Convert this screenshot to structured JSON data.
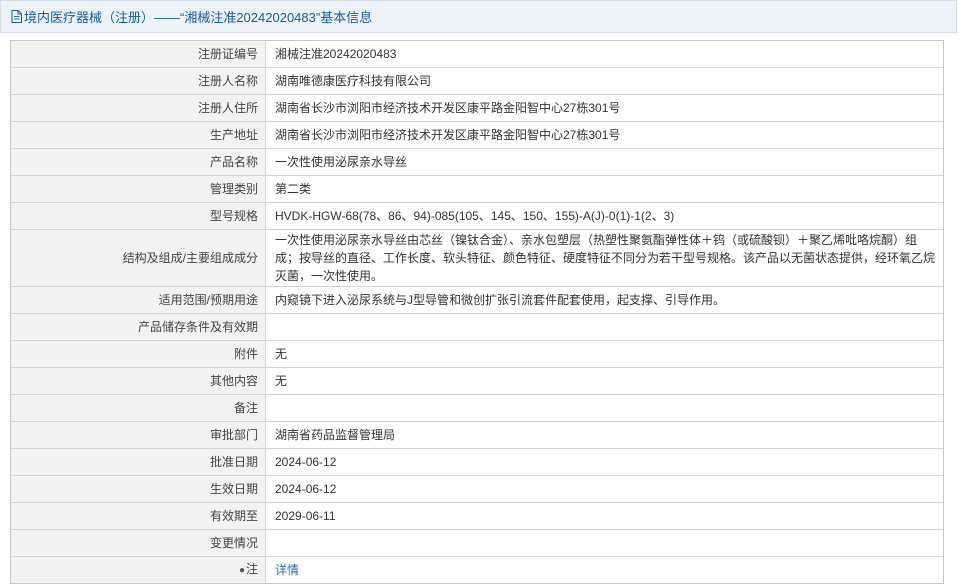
{
  "header": {
    "title": "境内医疗器械（注册）——“湘械注准20242020483”基本信息",
    "icon": "document-icon"
  },
  "rows": [
    {
      "label": "注册证编号",
      "value": "湘械注准20242020483"
    },
    {
      "label": "注册人名称",
      "value": "湖南唯德康医疗科技有限公司"
    },
    {
      "label": "注册人住所",
      "value": "湖南省长沙市浏阳市经济技术开发区康平路金阳智中心27栋301号"
    },
    {
      "label": "生产地址",
      "value": "湖南省长沙市浏阳市经济技术开发区康平路金阳智中心27栋301号"
    },
    {
      "label": "产品名称",
      "value": "一次性使用泌尿亲水导丝"
    },
    {
      "label": "管理类别",
      "value": "第二类"
    },
    {
      "label": "型号规格",
      "value": "HVDK-HGW-68(78、86、94)-085(105、145、150、155)-A(J)-0(1)-1(2、3)"
    },
    {
      "label": "结构及组成/主要组成成分",
      "value": "一次性使用泌尿亲水导丝由芯丝（镍钛合金）、亲水包塑层（热塑性聚氨酯弹性体＋钨（或硫酸钡）＋聚乙烯吡咯烷酮）组成；按导丝的直径、工作长度、软头特征、颜色特征、硬度特征不同分为若干型号规格。该产品以无菌状态提供，经环氧乙烷灭菌，一次性使用。"
    },
    {
      "label": "适用范围/预期用途",
      "value": "内窥镜下进入泌尿系统与J型导管和微创扩张引流套件配套使用，起支撑、引导作用。"
    },
    {
      "label": "产品储存条件及有效期",
      "value": ""
    },
    {
      "label": "附件",
      "value": "无"
    },
    {
      "label": "其他内容",
      "value": "无"
    },
    {
      "label": "备注",
      "value": ""
    },
    {
      "label": "审批部门",
      "value": "湖南省药品监督管理局"
    },
    {
      "label": "批准日期",
      "value": "2024-06-12"
    },
    {
      "label": "生效日期",
      "value": "2024-06-12"
    },
    {
      "label": "有效期至",
      "value": "2029-06-11"
    },
    {
      "label": "变更情况",
      "value": ""
    }
  ],
  "note": {
    "label": "注",
    "icon": "pin-icon",
    "link": "详情"
  }
}
